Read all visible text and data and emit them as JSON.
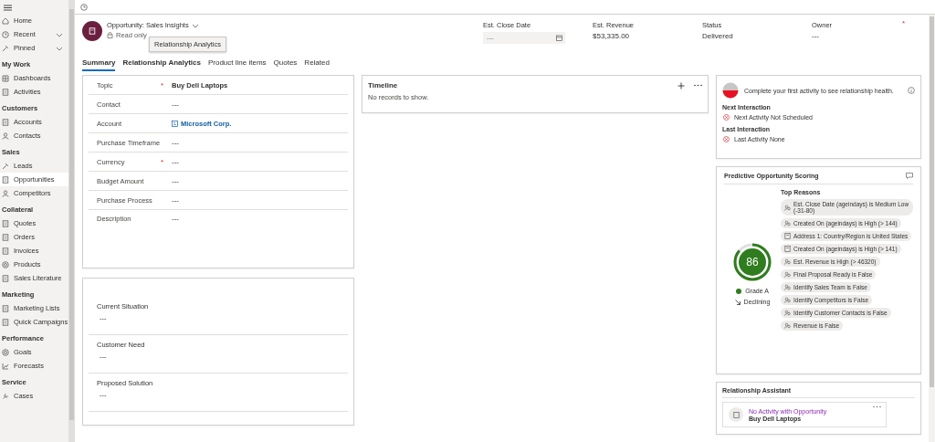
{
  "sidebar": {
    "groups": [
      {
        "items": [
          {
            "label": "Home",
            "selected": false
          },
          {
            "label": "Recent",
            "expandable": true,
            "selected": false
          },
          {
            "label": "Pinned",
            "expandable": true,
            "selected": false
          }
        ]
      },
      {
        "heading": "My Work",
        "items": [
          {
            "label": "Dashboards",
            "selected": false
          },
          {
            "label": "Activities",
            "selected": false
          }
        ]
      },
      {
        "heading": "Customers",
        "items": [
          {
            "label": "Accounts",
            "selected": false
          },
          {
            "label": "Contacts",
            "selected": false
          }
        ]
      },
      {
        "heading": "Sales",
        "items": [
          {
            "label": "Leads",
            "selected": false
          },
          {
            "label": "Opportunities",
            "selected": true
          },
          {
            "label": "Competitors",
            "selected": false
          }
        ]
      },
      {
        "heading": "Collateral",
        "items": [
          {
            "label": "Quotes",
            "selected": false
          },
          {
            "label": "Orders",
            "selected": false
          },
          {
            "label": "Invoices",
            "selected": false
          },
          {
            "label": "Products",
            "selected": false
          },
          {
            "label": "Sales Literature",
            "selected": false
          }
        ]
      },
      {
        "heading": "Marketing",
        "items": [
          {
            "label": "Marketing Lists",
            "selected": false
          },
          {
            "label": "Quick Campaigns",
            "selected": false
          }
        ]
      },
      {
        "heading": "Performance",
        "items": [
          {
            "label": "Goals",
            "selected": false
          },
          {
            "label": "Forecasts",
            "selected": false
          }
        ]
      },
      {
        "heading": "Service",
        "items": [
          {
            "label": "Cases",
            "selected": false
          }
        ]
      }
    ]
  },
  "header": {
    "title": "Opportunity: Sales Insights",
    "subtitle": "Read only",
    "tooltip": "Relationship Analytics",
    "fields": [
      {
        "kind": "date",
        "label": "Est. Close Date",
        "placeholder": "---"
      },
      {
        "kind": "text",
        "label": "Est. Revenue",
        "value": "$53,335.00"
      },
      {
        "kind": "text",
        "label": "Status",
        "value": "Delivered"
      },
      {
        "kind": "text",
        "label": "Owner",
        "value": "---",
        "required_marker": "*"
      }
    ]
  },
  "tabs": [
    {
      "label": "Summary",
      "selected": true,
      "hovered": false
    },
    {
      "label": "Relationship Analytics",
      "selected": false,
      "hovered": true
    },
    {
      "label": "Product line items",
      "selected": false,
      "hovered": false
    },
    {
      "label": "Quotes",
      "selected": false,
      "hovered": false
    },
    {
      "label": "Related",
      "selected": false,
      "hovered": false
    }
  ],
  "details": [
    {
      "kind": "text",
      "label": "Topic",
      "required_marker": "*",
      "value": "Buy Dell Laptops",
      "bold": true
    },
    {
      "kind": "text",
      "label": "Contact",
      "value": "---",
      "bold": false
    },
    {
      "kind": "link",
      "label": "Account",
      "value": "Microsoft Corp.",
      "bold": true
    },
    {
      "kind": "text",
      "label": "Purchase Timeframe",
      "value": "---",
      "bold": false
    },
    {
      "kind": "text",
      "label": "Currency",
      "required_marker": "*",
      "value": "---",
      "bold": false
    },
    {
      "kind": "text",
      "label": "Budget Amount",
      "value": "---",
      "bold": false
    },
    {
      "kind": "text",
      "label": "Purchase Process",
      "value": "---",
      "bold": false
    },
    {
      "kind": "text",
      "label": "Description",
      "value": "---",
      "bold": false
    }
  ],
  "notes": [
    {
      "label": "Current Situation",
      "value": "---"
    },
    {
      "label": "Customer Need",
      "value": "---"
    },
    {
      "label": "Proposed Solution",
      "value": "---"
    }
  ],
  "timeline": {
    "title": "Timeline",
    "empty": "No records to show."
  },
  "health": {
    "message": "Complete your first activity to see relationship health.",
    "sections": [
      {
        "heading": "Next Interaction",
        "value": "Next Activity Not Scheduled"
      },
      {
        "heading": "Last Interaction",
        "value": "Last Activity None"
      }
    ]
  },
  "scoring": {
    "title": "Predictive Opportunity Scoring",
    "score": "86",
    "grade": "Grade A",
    "trend": "Declining",
    "reasons_title": "Top Reasons",
    "reasons": [
      {
        "kind": "trend",
        "text": "Est. Close Date (ageindays) is Medium Low (-31-80)"
      },
      {
        "kind": "trend",
        "text": "Created On (ageindays) is High (> 144)"
      },
      {
        "kind": "record",
        "text": "Address 1: Country/Region is United States"
      },
      {
        "kind": "record",
        "text": "Created On (ageindays) is High (> 141)"
      },
      {
        "kind": "trend",
        "text": "Est. Revenue is High (> 46320)"
      },
      {
        "kind": "trend",
        "text": "Final Proposal Ready is False"
      },
      {
        "kind": "trend",
        "text": "Identify Sales Team is False"
      },
      {
        "kind": "trend",
        "text": "Identify Competitors is False"
      },
      {
        "kind": "trend",
        "text": "Identify Customer Contacts is False"
      },
      {
        "kind": "trend",
        "text": "Revenue is False"
      }
    ]
  },
  "assistant": {
    "title": "Relationship Assistant",
    "card": {
      "title": "No Activity with Opportunity",
      "subtitle": "Buy Dell Laptops"
    }
  }
}
